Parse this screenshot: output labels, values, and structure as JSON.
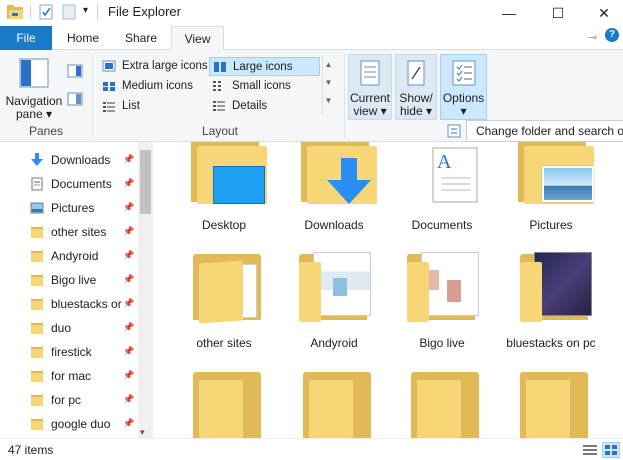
{
  "window": {
    "title": "File Explorer"
  },
  "tabs": {
    "file": "File",
    "home": "Home",
    "share": "Share",
    "view": "View"
  },
  "ribbon": {
    "panes": {
      "navigation_pane": "Navigation",
      "navigation_pane_2": "pane ▾",
      "group_label": "Panes"
    },
    "layout": {
      "extra_large": "Extra large icons",
      "large": "Large icons",
      "medium": "Medium icons",
      "small": "Small icons",
      "list": "List",
      "details": "Details",
      "group_label": "Layout"
    },
    "current_view": {
      "l1": "Current",
      "l2": "view ▾"
    },
    "show_hide": {
      "l1": "Show/",
      "l2": "hide ▾"
    },
    "options": {
      "l1": "Options",
      "l2": "▾"
    }
  },
  "tooltip": {
    "text": "Change folder and search op"
  },
  "nav": {
    "items": [
      {
        "label": "Downloads"
      },
      {
        "label": "Documents"
      },
      {
        "label": "Pictures"
      },
      {
        "label": "other sites"
      },
      {
        "label": "Andyroid"
      },
      {
        "label": "Bigo live"
      },
      {
        "label": "bluestacks or"
      },
      {
        "label": "duo"
      },
      {
        "label": "firestick"
      },
      {
        "label": "for mac"
      },
      {
        "label": "for pc"
      },
      {
        "label": "google duo"
      }
    ]
  },
  "main": {
    "row1": [
      {
        "label": "Desktop"
      },
      {
        "label": "Downloads"
      },
      {
        "label": "Documents"
      },
      {
        "label": "Pictures"
      }
    ],
    "row2": [
      {
        "label": "other sites"
      },
      {
        "label": "Andyroid"
      },
      {
        "label": "Bigo live"
      },
      {
        "label": "bluestacks on pc"
      }
    ]
  },
  "status": {
    "count": "47 items"
  },
  "colors": {
    "accent": "#1979ca",
    "folder_back": "#e2b957",
    "folder_front": "#f6d676",
    "selection": "#cce8ff"
  }
}
